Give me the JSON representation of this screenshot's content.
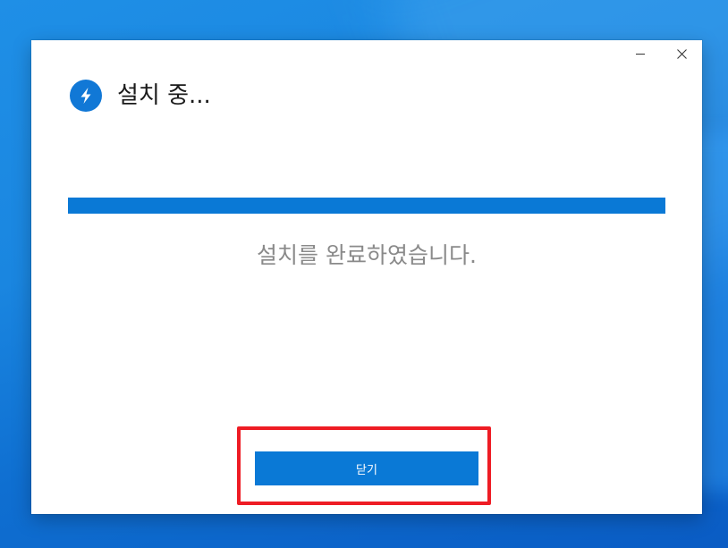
{
  "window": {
    "title": "설치 중...",
    "controls": {
      "minimize_icon": "minimize-icon",
      "close_icon": "close-icon"
    }
  },
  "app_icon": "lightning-bolt-icon",
  "progress": {
    "value_percent": 100
  },
  "status_text": "설치를 완료하였습니다.",
  "close_button": {
    "label": "닫기"
  },
  "colors": {
    "accent": "#0a79d6",
    "annotation_highlight": "#ee1c24",
    "status_text": "#8a8a8a"
  }
}
